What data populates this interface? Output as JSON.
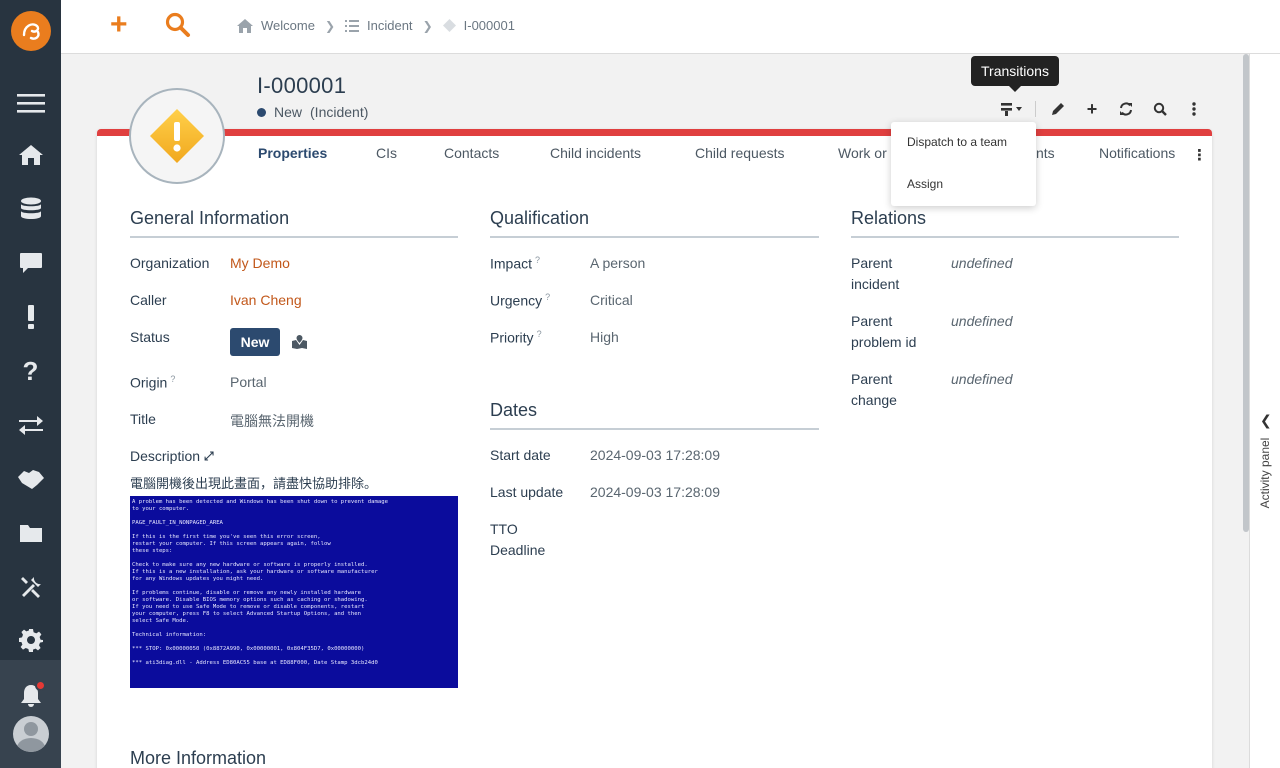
{
  "nav": {
    "icons": [
      "logo-icon",
      "menu-icon",
      "home-icon",
      "database-icon",
      "chat-icon",
      "alert-icon",
      "help-icon",
      "transfer-icon",
      "handshake-icon",
      "folder-icon",
      "tools-icon",
      "gear-icon",
      "bell-icon",
      "user-avatar"
    ]
  },
  "breadcrumb": {
    "items": [
      "Welcome",
      "Incident",
      "I-000001"
    ]
  },
  "object": {
    "title": "I-000001",
    "state": "New",
    "class": "(Incident)"
  },
  "tooltip": "Transitions",
  "transitions_menu": [
    "Dispatch to a team",
    "Assign"
  ],
  "tabs": [
    "Properties",
    "CIs",
    "Contacts",
    "Child incidents",
    "Child requests",
    "Work or",
    "nts",
    "Notifications"
  ],
  "general": {
    "title": "General Information",
    "organization_label": "Organization",
    "organization_value": "My Demo",
    "caller_label": "Caller",
    "caller_value": "Ivan Cheng",
    "status_label": "Status",
    "status_value": "New",
    "origin_label": "Origin",
    "origin_value": "Portal",
    "title_label": "Title",
    "title_value": "電腦無法開機",
    "description_label": "Description",
    "description_value": "電腦開機後出現此畫面，請盡快協助排除。"
  },
  "bsod_text": "A problem has been detected and Windows has been shut down to prevent damage\nto your computer.\n\nPAGE_FAULT_IN_NONPAGED_AREA\n\nIf this is the first time you've seen this error screen,\nrestart your computer. If this screen appears again, follow\nthese steps:\n\nCheck to make sure any new hardware or software is properly installed.\nIf this is a new installation, ask your hardware or software manufacturer\nfor any Windows updates you might need.\n\nIf problems continue, disable or remove any newly installed hardware\nor software. Disable BIOS memory options such as caching or shadowing.\nIf you need to use Safe Mode to remove or disable components, restart\nyour computer, press F8 to select Advanced Startup Options, and then\nselect Safe Mode.\n\nTechnical information:\n\n*** STOP: 0x00000050 (0x8872A990, 0x00000001, 0x804F35D7, 0x00000000)\n\n*** ati3diag.dll - Address ED80AC55 base at ED88F000, Date Stamp 3dcb24d0",
  "qualification": {
    "title": "Qualification",
    "impact_label": "Impact",
    "impact_value": "A person",
    "urgency_label": "Urgency",
    "urgency_value": "Critical",
    "priority_label": "Priority",
    "priority_value": "High"
  },
  "dates": {
    "title": "Dates",
    "start_label": "Start date",
    "start_value": "2024-09-03 17:28:09",
    "update_label": "Last update",
    "update_value": "2024-09-03 17:28:09",
    "tto_label_1": "TTO",
    "tto_label_2": "Deadline"
  },
  "relations": {
    "title": "Relations",
    "parent_incident_1": "Parent",
    "parent_incident_2": "incident",
    "parent_incident_value": "undefined",
    "parent_problem_1": "Parent",
    "parent_problem_2": "problem id",
    "parent_problem_value": "undefined",
    "parent_change_1": "Parent",
    "parent_change_2": "change",
    "parent_change_value": "undefined"
  },
  "more_info_title": "More Information",
  "activity_panel": "Activity panel",
  "colors": {
    "brand": "#ea7d1e",
    "nav_bg": "#283440",
    "priority_bar": "#e03f3f",
    "status_pill": "#2c4a6f",
    "link": "#c2581b"
  }
}
